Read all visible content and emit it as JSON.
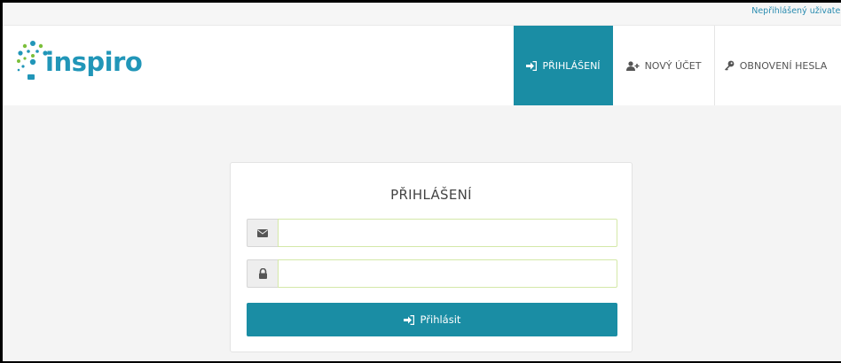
{
  "topbar": {
    "user_status": "Nepřihlášený uživatel"
  },
  "brand": {
    "logo_text": "inspiro"
  },
  "nav": {
    "login": "PŘIHLÁŠENÍ",
    "new_account": "NOVÝ ÚČET",
    "password_reset": "OBNOVENÍ HESLA"
  },
  "login_form": {
    "title": "PŘIHLÁŠENÍ",
    "email_value": "",
    "password_value": "",
    "submit_label": "Přihlásit"
  },
  "colors": {
    "accent": "#1a8da4",
    "link": "#2a8cb0",
    "logo": "#2196b8"
  }
}
